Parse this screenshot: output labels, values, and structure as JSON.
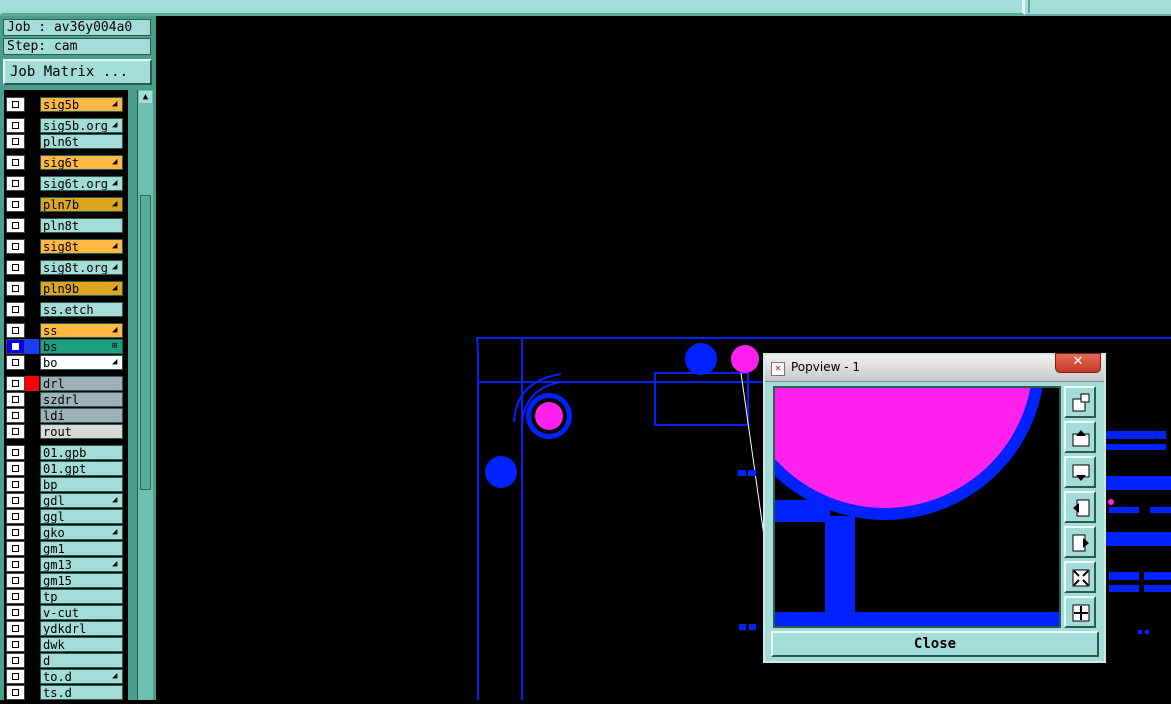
{
  "job": {
    "line1": "Job : av36y004a0",
    "line2": "Step: cam"
  },
  "job_matrix_label": "Job Matrix ...",
  "layers": [
    {
      "name": "sig5b",
      "style": "orange",
      "mark": "◢"
    },
    {
      "name": "sig5b.org",
      "style": "normal",
      "mark": "◢"
    },
    {
      "name": "pln6t",
      "style": "normal",
      "mark": ""
    },
    {
      "name": "sig6t",
      "style": "orange",
      "mark": "◢"
    },
    {
      "name": "sig6t.org",
      "style": "normal",
      "mark": "◢"
    },
    {
      "name": "pln7b",
      "style": "gold",
      "mark": "◢"
    },
    {
      "name": "pln8t",
      "style": "normal",
      "mark": ""
    },
    {
      "name": "sig8t",
      "style": "orange",
      "mark": "◢"
    },
    {
      "name": "sig8t.org",
      "style": "normal",
      "mark": "◢"
    },
    {
      "name": "pln9b",
      "style": "gold",
      "mark": "◢"
    },
    {
      "name": "ss.etch",
      "style": "normal",
      "mark": ""
    },
    {
      "name": "ss",
      "style": "orange",
      "mark": "◢"
    },
    {
      "name": "bs",
      "style": "green",
      "mark": "⊞"
    },
    {
      "name": "bo",
      "style": "white",
      "mark": "◢"
    },
    {
      "name": "drl",
      "style": "grey",
      "mark": ""
    },
    {
      "name": "szdrl",
      "style": "grey",
      "mark": ""
    },
    {
      "name": "ldi",
      "style": "grey",
      "mark": ""
    },
    {
      "name": "rout",
      "style": "lgrey",
      "mark": ""
    },
    {
      "name": "01.gpb",
      "style": "normal",
      "mark": ""
    },
    {
      "name": "01.gpt",
      "style": "normal",
      "mark": ""
    },
    {
      "name": "bp",
      "style": "normal",
      "mark": ""
    },
    {
      "name": "gdl",
      "style": "normal",
      "mark": "◢"
    },
    {
      "name": "ggl",
      "style": "normal",
      "mark": ""
    },
    {
      "name": "gko",
      "style": "normal",
      "mark": "◢"
    },
    {
      "name": "gm1",
      "style": "normal",
      "mark": ""
    },
    {
      "name": "gm13",
      "style": "normal",
      "mark": "◢"
    },
    {
      "name": "gm15",
      "style": "normal",
      "mark": ""
    },
    {
      "name": "tp",
      "style": "normal",
      "mark": ""
    },
    {
      "name": "v-cut",
      "style": "normal",
      "mark": ""
    },
    {
      "name": "ydkdrl",
      "style": "normal",
      "mark": ""
    },
    {
      "name": "dwk",
      "style": "normal",
      "mark": ""
    },
    {
      "name": "d",
      "style": "normal",
      "mark": ""
    },
    {
      "name": "to.d",
      "style": "normal",
      "mark": "◢"
    },
    {
      "name": "ts.d",
      "style": "normal",
      "mark": ""
    }
  ],
  "popview": {
    "title": "Popview - 1",
    "close_x": "✕",
    "close_label": "Close",
    "buttons": [
      "zoom-home-icon",
      "pan-up-icon",
      "pan-down-icon",
      "pan-left-icon",
      "pan-right-icon",
      "zoom-fit-icon",
      "zoom-center-icon"
    ]
  },
  "colors": {
    "panel": "#4a9e8c",
    "widget": "#a4dcd8",
    "layer_orange": "#ffb844",
    "layer_gold": "#dca620",
    "feature_blue": "#0022ff",
    "feature_magenta": "#ff22ee"
  }
}
